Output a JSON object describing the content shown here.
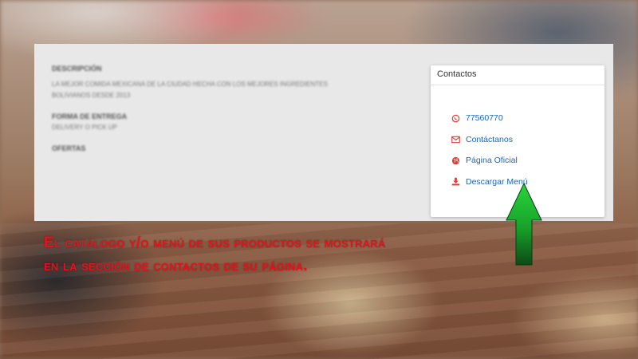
{
  "description": {
    "title": "DESCRIPCIÓN",
    "text_line1": "LA MEJOR COMIDA MEXICANA DE LA CIUDAD HECHA CON LOS MEJORES INGREDIENTES",
    "text_line2": "BOLIVIANOS DESDE 2013"
  },
  "delivery": {
    "title": "FORMA DE ENTREGA",
    "text": "DELIVERY O PICK UP"
  },
  "offers": {
    "title": "OFERTAS"
  },
  "contacts": {
    "header": "Contactos",
    "items": [
      {
        "icon": "whatsapp-icon",
        "label": "77560770"
      },
      {
        "icon": "envelope-icon",
        "label": "Contáctanos"
      },
      {
        "icon": "globe-icon",
        "label": "Página Oficial"
      },
      {
        "icon": "download-icon",
        "label": "Descargar Menú"
      }
    ],
    "icon_color": "#e53935",
    "link_color": "#1565c0"
  },
  "caption": {
    "line1": "El catálogo y/o menú de sus productos se mostrará",
    "line2": "en la sección de contactos de su página.",
    "color": "#e8101a"
  },
  "arrow": {
    "color": "#1fb52e"
  }
}
